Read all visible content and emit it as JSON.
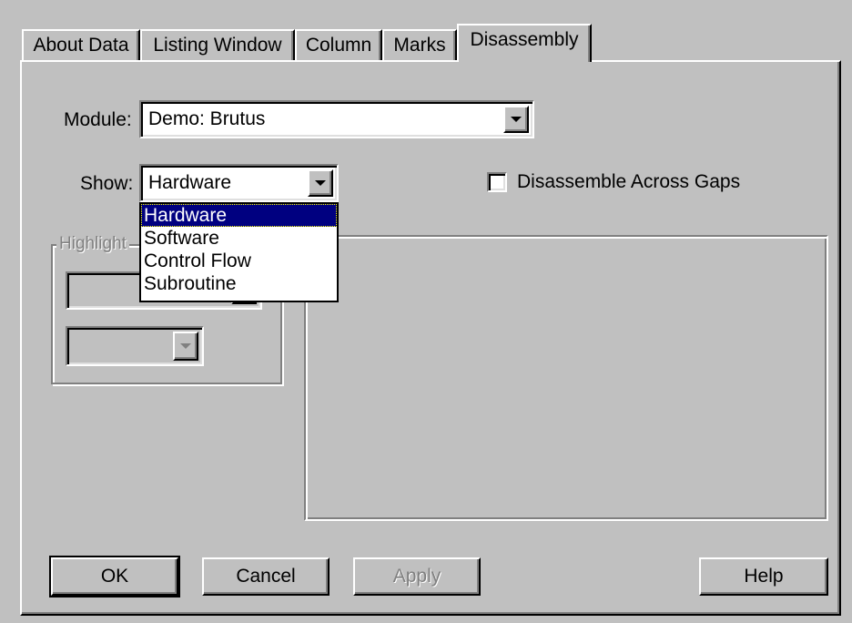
{
  "tabs": [
    {
      "label": "About Data"
    },
    {
      "label": "Listing Window"
    },
    {
      "label": "Column"
    },
    {
      "label": "Marks"
    },
    {
      "label": "Disassembly"
    }
  ],
  "module": {
    "label": "Module:",
    "value": "Demo: Brutus"
  },
  "show": {
    "label": "Show:",
    "value": "Hardware",
    "options": [
      "Hardware",
      "Software",
      "Control Flow",
      "Subroutine"
    ],
    "selected": "Hardware"
  },
  "disassemble_across_gaps": {
    "label": "Disassemble Across Gaps",
    "checked": false
  },
  "highlight_group": {
    "title": "Highlight"
  },
  "buttons": {
    "ok": "OK",
    "cancel": "Cancel",
    "apply": "Apply",
    "help": "Help"
  },
  "colors": {
    "face": "#c0c0c0",
    "selection": "#000080"
  }
}
